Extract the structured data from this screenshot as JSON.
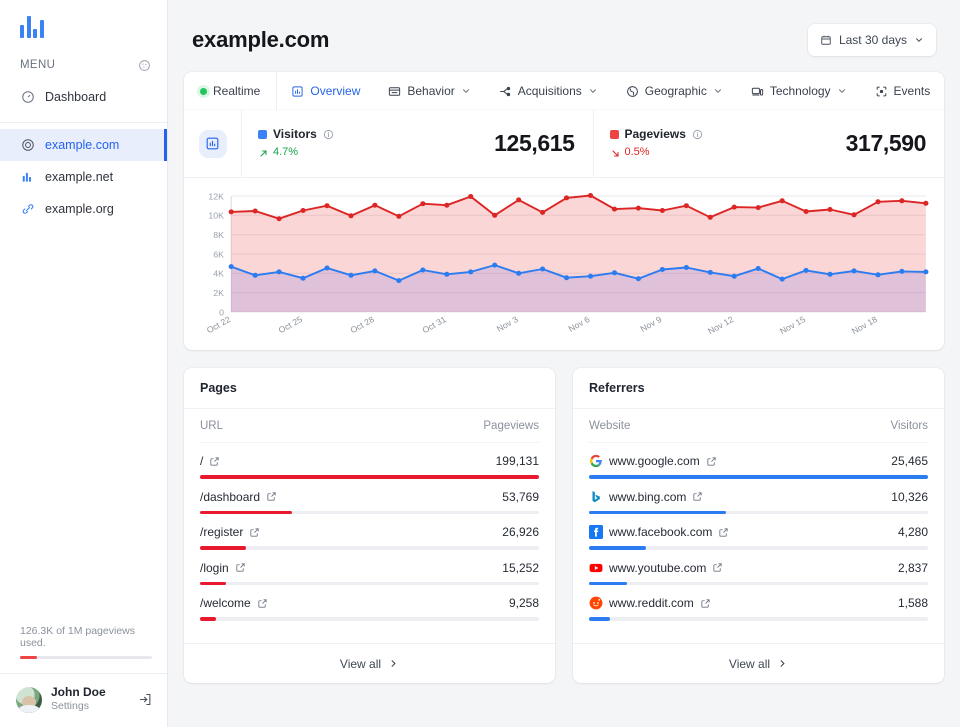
{
  "brand": {
    "logo_icon": "bar-chart-logo-icon",
    "accent": "#3b82f6"
  },
  "sidebar": {
    "menu_label": "MENU",
    "theme_icon": "palette-icon",
    "nav": [
      {
        "label": "Dashboard",
        "icon": "gauge-icon"
      }
    ],
    "sites": [
      {
        "label": "example.com",
        "icon": "target-icon",
        "active": true
      },
      {
        "label": "example.net",
        "icon": "bar-chart-icon",
        "active": false
      },
      {
        "label": "example.org",
        "icon": "link-icon",
        "active": false
      }
    ],
    "quota": {
      "text": "126.3K of 1M pageviews used.",
      "percent": 12.6,
      "color": "#ef4444"
    },
    "user": {
      "name": "John Doe",
      "subtitle": "Settings",
      "avatar_icon": "avatar",
      "logout_icon": "logout-icon"
    }
  },
  "header": {
    "title": "example.com",
    "daterange": {
      "label": "Last 30 days",
      "calendar_icon": "calendar-icon",
      "chevron_icon": "chevron-down-icon"
    }
  },
  "tabs": [
    {
      "label": "Realtime",
      "icon": "green-dot-icon",
      "active": false,
      "chevron": false
    },
    {
      "label": "Overview",
      "icon": "chart-box-icon",
      "active": true,
      "chevron": false
    },
    {
      "label": "Behavior",
      "icon": "window-icon",
      "active": false,
      "chevron": true
    },
    {
      "label": "Acquisitions",
      "icon": "branch-icon",
      "active": false,
      "chevron": true
    },
    {
      "label": "Geographic",
      "icon": "globe-icon",
      "active": false,
      "chevron": true
    },
    {
      "label": "Technology",
      "icon": "device-icon",
      "active": false,
      "chevron": true
    },
    {
      "label": "Events",
      "icon": "target-focus-icon",
      "active": false,
      "chevron": false
    }
  ],
  "metrics": {
    "badge_icon": "chart-box-icon",
    "items": [
      {
        "name": "Visitors",
        "color": "#3b82f6",
        "value": "125,615",
        "delta": "4.7%",
        "direction": "up",
        "info_icon": "info-icon",
        "arrow_icon": "arrow-up-right-icon"
      },
      {
        "name": "Pageviews",
        "color": "#ef4444",
        "value": "317,590",
        "delta": "0.5%",
        "direction": "down",
        "info_icon": "info-icon",
        "arrow_icon": "arrow-down-right-icon"
      }
    ]
  },
  "chart_data": {
    "type": "line",
    "title": "",
    "xlabel": "",
    "ylabel": "",
    "grid": true,
    "legend_position": "top",
    "ylim": [
      0,
      12000
    ],
    "yticks": [
      0,
      2000,
      4000,
      6000,
      8000,
      10000,
      12000
    ],
    "ytick_labels": [
      "0",
      "2K",
      "4K",
      "6K",
      "8K",
      "10K",
      "12K"
    ],
    "x": [
      "Oct 22",
      "Oct 23",
      "Oct 24",
      "Oct 25",
      "Oct 26",
      "Oct 27",
      "Oct 28",
      "Oct 29",
      "Oct 30",
      "Oct 31",
      "Nov 1",
      "Nov 2",
      "Nov 3",
      "Nov 4",
      "Nov 5",
      "Nov 6",
      "Nov 7",
      "Nov 8",
      "Nov 9",
      "Nov 10",
      "Nov 11",
      "Nov 12",
      "Nov 13",
      "Nov 14",
      "Nov 15",
      "Nov 16",
      "Nov 17",
      "Nov 18",
      "Nov 19",
      "Nov 20"
    ],
    "xtick_labels": [
      "Oct 22",
      "Oct 25",
      "Oct 28",
      "Oct 31",
      "Nov 3",
      "Nov 6",
      "Nov 9",
      "Nov 12",
      "Nov 15",
      "Nov 18"
    ],
    "xtick_indices": [
      0,
      3,
      6,
      9,
      12,
      15,
      18,
      21,
      24,
      27
    ],
    "series": [
      {
        "name": "Pageviews",
        "color": "#dc2626",
        "fill": "rgba(239,68,68,0.22)",
        "values": [
          10350,
          10450,
          9650,
          10500,
          11000,
          9950,
          11050,
          9900,
          11200,
          11050,
          11950,
          10000,
          11600,
          10300,
          11800,
          12050,
          10650,
          10750,
          10500,
          11000,
          9800,
          10850,
          10800,
          11500,
          10400,
          10600,
          10050,
          11400,
          11500,
          11250
        ]
      },
      {
        "name": "Visitors",
        "color": "#2b7cf0",
        "fill": "rgba(99,102,241,0.18)",
        "values": [
          4700,
          3800,
          4150,
          3500,
          4550,
          3800,
          4250,
          3250,
          4350,
          3900,
          4150,
          4850,
          4000,
          4450,
          3550,
          3700,
          4050,
          3450,
          4400,
          4600,
          4100,
          3700,
          4500,
          3400,
          4300,
          3900,
          4250,
          3850,
          4200,
          4150
        ]
      }
    ]
  },
  "pages_card": {
    "title": "Pages",
    "columns": [
      "URL",
      "Pageviews"
    ],
    "bar_color": "#e8192f",
    "max": 199131,
    "rows": [
      {
        "label": "/",
        "value": "199,131",
        "raw": 199131,
        "ext_icon": "external-link-icon"
      },
      {
        "label": "/dashboard",
        "value": "53,769",
        "raw": 53769,
        "ext_icon": "external-link-icon"
      },
      {
        "label": "/register",
        "value": "26,926",
        "raw": 26926,
        "ext_icon": "external-link-icon"
      },
      {
        "label": "/login",
        "value": "15,252",
        "raw": 15252,
        "ext_icon": "external-link-icon"
      },
      {
        "label": "/welcome",
        "value": "9,258",
        "raw": 9258,
        "ext_icon": "external-link-icon"
      }
    ],
    "footer": {
      "label": "View all",
      "chevron_icon": "chevron-right-icon"
    }
  },
  "referrers_card": {
    "title": "Referrers",
    "columns": [
      "Website",
      "Visitors"
    ],
    "bar_color": "#2b7cf0",
    "max": 25465,
    "rows": [
      {
        "label": "www.google.com",
        "value": "25,465",
        "raw": 25465,
        "favicon": "google-icon",
        "ext_icon": "external-link-icon"
      },
      {
        "label": "www.bing.com",
        "value": "10,326",
        "raw": 10326,
        "favicon": "bing-icon",
        "ext_icon": "external-link-icon"
      },
      {
        "label": "www.facebook.com",
        "value": "4,280",
        "raw": 4280,
        "favicon": "facebook-icon",
        "ext_icon": "external-link-icon"
      },
      {
        "label": "www.youtube.com",
        "value": "2,837",
        "raw": 2837,
        "favicon": "youtube-icon",
        "ext_icon": "external-link-icon"
      },
      {
        "label": "www.reddit.com",
        "value": "1,588",
        "raw": 1588,
        "favicon": "reddit-icon",
        "ext_icon": "external-link-icon"
      }
    ],
    "footer": {
      "label": "View all",
      "chevron_icon": "chevron-right-icon"
    }
  }
}
